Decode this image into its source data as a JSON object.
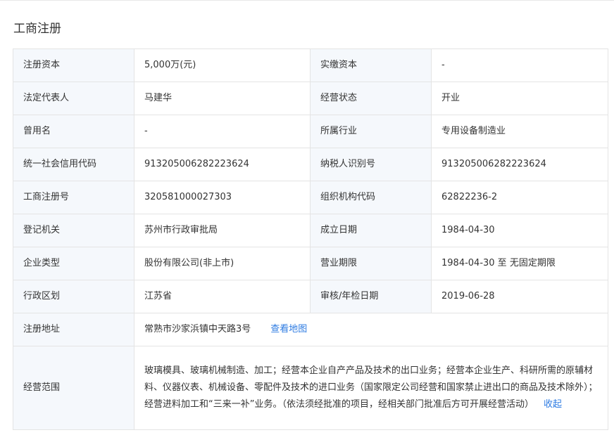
{
  "section_title": "工商注册",
  "rows": [
    {
      "k1": "注册资本",
      "v1": "5,000万(元)",
      "k2": "实缴资本",
      "v2": "-"
    },
    {
      "k1": "法定代表人",
      "v1": "马建华",
      "k2": "经营状态",
      "v2": "开业"
    },
    {
      "k1": "曾用名",
      "v1": "-",
      "k2": "所属行业",
      "v2": "专用设备制造业"
    },
    {
      "k1": "统一社会信用代码",
      "v1": "913205006282223624",
      "k2": "纳税人识别号",
      "v2": "913205006282223624"
    },
    {
      "k1": "工商注册号",
      "v1": "320581000027303",
      "k2": "组织机构代码",
      "v2": "62822236-2"
    },
    {
      "k1": "登记机关",
      "v1": "苏州市行政审批局",
      "k2": "成立日期",
      "v2": "1984-04-30"
    },
    {
      "k1": "企业类型",
      "v1": "股份有限公司(非上市)",
      "k2": "营业期限",
      "v2": "1984-04-30 至 无固定期限"
    },
    {
      "k1": "行政区划",
      "v1": "江苏省",
      "k2": "审核/年检日期",
      "v2": "2019-06-28"
    }
  ],
  "address": {
    "label": "注册地址",
    "value": "常熟市沙家浜镇中天路3号",
    "map_link": "查看地图"
  },
  "scope": {
    "label": "经营范围",
    "value": "玻璃模具、玻璃机械制造、加工；经营本企业自产产品及技术的出口业务；经营本企业生产、科研所需的原辅材料、仪器仪表、机械设备、零配件及技术的进口业务（国家限定公司经营和国家禁止进出口的商品及技术除外）；经营进料加工和“三来一补”业务。（依法须经批准的项目，经相关部门批准后方可开展经营活动）",
    "collapse_link": "收起"
  },
  "colors": {
    "key_bg": "#f5f8fc",
    "border": "#e4e4e4",
    "link": "#2d7be2",
    "text": "#333333"
  }
}
